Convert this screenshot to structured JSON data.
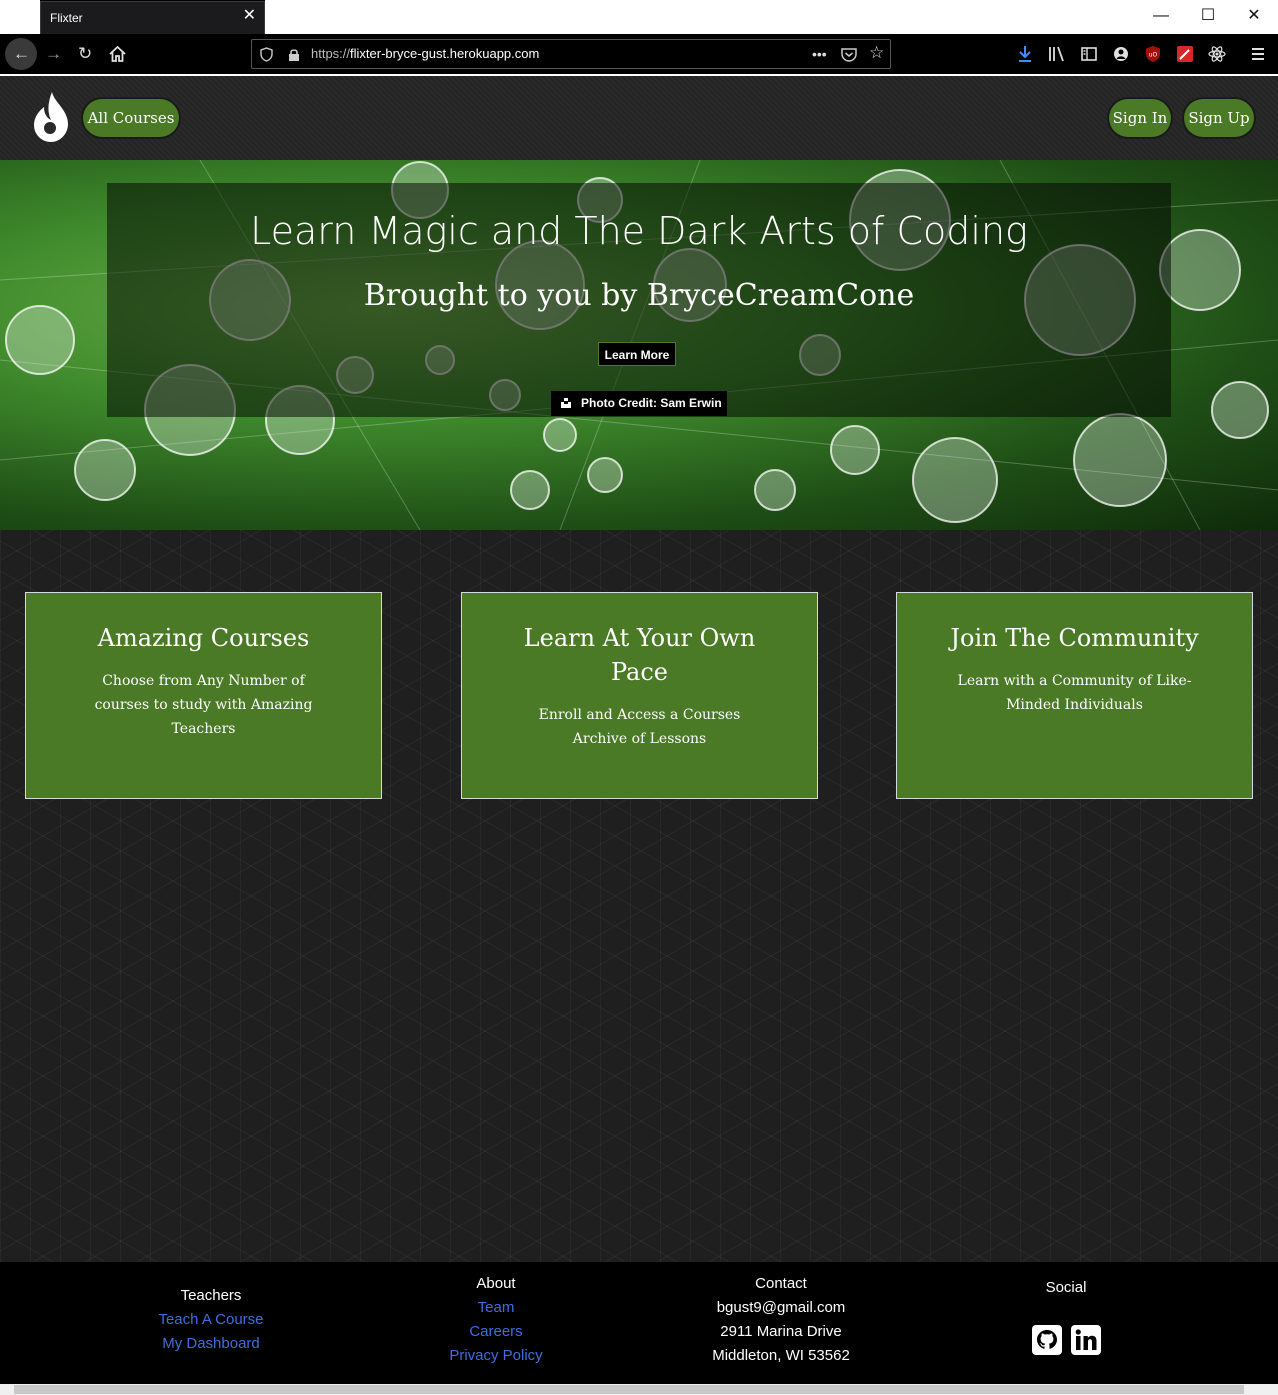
{
  "browser": {
    "tab_title": "Flixter",
    "tab_close": "✕",
    "url_prefix": "https://",
    "url_host": "flixter-bryce-gust.herokuapp.com",
    "window_minimize": "—",
    "window_maximize": "☐",
    "window_close": "✕"
  },
  "header": {
    "all_courses": "All Courses",
    "sign_in": "Sign In",
    "sign_up": "Sign Up"
  },
  "hero": {
    "title": "Learn Magic and The Dark Arts of Coding",
    "subtitle": "Brought to you by BryceCreamCone",
    "learn_more": "Learn More",
    "photo_credit": "Photo Credit: Sam Erwin"
  },
  "features": [
    {
      "title": "Amazing Courses",
      "text": "Choose from Any Number of courses to study with Amazing Teachers"
    },
    {
      "title": "Learn At Your Own Pace",
      "text": "Enroll and Access a Courses Archive of Lessons"
    },
    {
      "title": "Join The Community",
      "text": "Learn with a Community of Like-Minded Individuals"
    }
  ],
  "footer": {
    "teachers": {
      "heading": "Teachers",
      "links": [
        "Teach A Course",
        "My Dashboard"
      ]
    },
    "about": {
      "heading": "About",
      "links": [
        "Team",
        "Careers",
        "Privacy Policy"
      ]
    },
    "contact": {
      "heading": "Contact",
      "lines": [
        "bgust9@gmail.com",
        "2911 Marina Drive",
        "Middleton, WI 53562"
      ]
    },
    "social": {
      "heading": "Social",
      "icons": [
        "github-icon",
        "linkedin-icon"
      ]
    }
  },
  "colors": {
    "brand_green": "#4a7a25",
    "link_blue": "#3e6ee0",
    "footer_bg": "#000000"
  }
}
